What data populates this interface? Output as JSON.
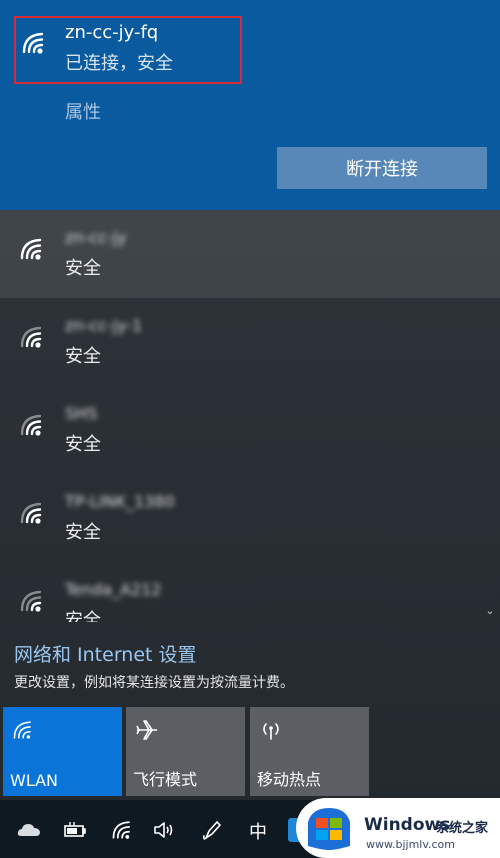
{
  "connected": {
    "ssid": "zn-cc-jy-fq",
    "status": "已连接，安全",
    "properties_label": "属性",
    "disconnect_label": "断开连接"
  },
  "networks": [
    {
      "ssid": "zn-cc-jy",
      "status": "安全"
    },
    {
      "ssid": "zn-cc-jy-1",
      "status": "安全"
    },
    {
      "ssid": "SHS",
      "status": "安全"
    },
    {
      "ssid": "TP-LINK_1380",
      "status": "安全"
    },
    {
      "ssid": "Tenda_A212",
      "status": "安全"
    }
  ],
  "settings": {
    "link": "网络和 Internet 设置",
    "description": "更改设置，例如将某连接设置为按流量计费。"
  },
  "quick_actions": [
    {
      "label": "WLAN",
      "icon": "wifi-icon",
      "active": true
    },
    {
      "label": "飞行模式",
      "icon": "airplane-icon",
      "active": false
    },
    {
      "label": "移动热点",
      "icon": "hotspot-icon",
      "active": false
    }
  ],
  "taskbar": {
    "ime": "中",
    "icons": [
      "onedrive-icon",
      "battery-icon",
      "wifi-icon",
      "volume-icon",
      "pen-icon"
    ]
  },
  "watermark": {
    "brand": "Windows",
    "brand_cn": "系统之家",
    "url": "www.bjjmlv.com"
  },
  "colors": {
    "connected_bg": "#0a5aa0",
    "highlight_border": "#d8283a",
    "active_tile": "#0a74d8",
    "link": "#9ac7ef"
  }
}
